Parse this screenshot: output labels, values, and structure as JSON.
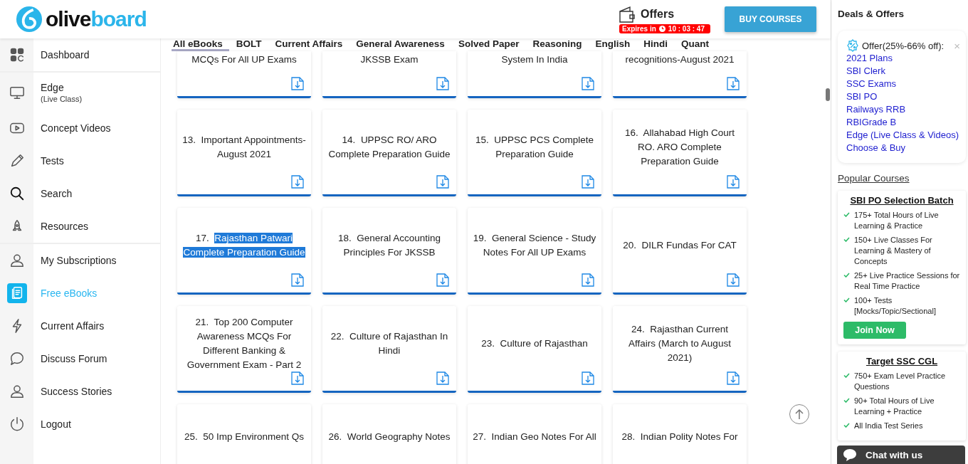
{
  "header": {
    "logo": {
      "dark": "olive",
      "light": "board"
    },
    "offers": {
      "label": "Offers",
      "expires_label": "Expires in",
      "countdown": "10 : 03 : 47"
    },
    "buy_button": "BUY COURSES"
  },
  "sidebar": {
    "groups": [
      [
        {
          "label": "Dashboard",
          "selected": false
        }
      ],
      [
        {
          "label": "Edge",
          "sublabel": "(Live Class)",
          "selected": false
        },
        {
          "label": "Concept Videos",
          "selected": false
        },
        {
          "label": "Tests",
          "selected": false
        },
        {
          "label": "Search",
          "selected": false
        },
        {
          "label": "Resources",
          "selected": false
        }
      ],
      [
        {
          "label": "My Subscriptions",
          "selected": false
        },
        {
          "label": "Free eBooks",
          "selected": true
        },
        {
          "label": "Current Affairs",
          "selected": false
        },
        {
          "label": "Discuss Forum",
          "selected": false
        },
        {
          "label": "Success Stories",
          "selected": false
        },
        {
          "label": "Logout",
          "selected": false
        }
      ]
    ]
  },
  "tabs": [
    {
      "label": "All eBooks",
      "selected": true
    },
    {
      "label": "BOLT",
      "selected": false
    },
    {
      "label": "Current Affairs",
      "selected": false
    },
    {
      "label": "General Awareness",
      "selected": false
    },
    {
      "label": "Solved Paper",
      "selected": false
    },
    {
      "label": "Reasoning",
      "selected": false
    },
    {
      "label": "English",
      "selected": false
    },
    {
      "label": "Hindi",
      "selected": false
    },
    {
      "label": "Quant",
      "selected": false
    }
  ],
  "ebook_rows": [
    [
      {
        "title": "MCQs For All UP Exams",
        "highlighted": false
      },
      {
        "title": "JKSSB Exam",
        "highlighted": false
      },
      {
        "title": "System In India",
        "highlighted": false
      },
      {
        "title": "recognitions-August 2021",
        "highlighted": false
      }
    ],
    [
      {
        "number": "13.",
        "title": "Important Appointments-August 2021",
        "highlighted": false
      },
      {
        "number": "14.",
        "title": "UPPSC RO/ ARO Complete Preparation Guide",
        "highlighted": false
      },
      {
        "number": "15.",
        "title": "UPPSC PCS Complete Preparation Guide",
        "highlighted": false
      },
      {
        "number": "16.",
        "title": "Allahabad High Court RO. ARO Complete Preparation Guide",
        "highlighted": false
      }
    ],
    [
      {
        "number": "17.",
        "title": "Rajasthan Patwari Complete Preparation Guide",
        "highlighted": true
      },
      {
        "number": "18.",
        "title": "General Accounting Principles For JKSSB",
        "highlighted": false
      },
      {
        "number": "19.",
        "title": "General Science - Study Notes For All UP Exams",
        "highlighted": false
      },
      {
        "number": "20.",
        "title": "DILR Fundas For CAT",
        "highlighted": false
      }
    ],
    [
      {
        "number": "21.",
        "title": "Top 200 Computer Awareness MCQs For Different Banking & Government Exam - Part 2",
        "highlighted": false
      },
      {
        "number": "22.",
        "title": "Culture of Rajasthan In Hindi",
        "highlighted": false
      },
      {
        "number": "23.",
        "title": "Culture of Rajasthan",
        "highlighted": false
      },
      {
        "number": "24.",
        "title": "Rajasthan Current Affairs (March to August 2021)",
        "highlighted": false
      }
    ],
    [
      {
        "number": "25.",
        "title": "50 Imp Environment Qs",
        "highlighted": false
      },
      {
        "number": "26.",
        "title": "World Geography Notes",
        "highlighted": false
      },
      {
        "number": "27.",
        "title": "Indian Geo Notes For All",
        "highlighted": false
      },
      {
        "number": "28.",
        "title": "Indian Polity Notes For",
        "highlighted": false
      }
    ]
  ],
  "deals": {
    "title": "Deals & Offers",
    "offer": {
      "label": "Offer(25%-66% off):",
      "close": "×",
      "links": [
        "2021 Plans",
        "SBI Clerk",
        "SSC Exams",
        "SBI PO",
        "Railways RRB",
        "RBIGrade B",
        "Edge (Live Class & Videos)",
        "Choose & Buy"
      ]
    }
  },
  "popular": {
    "title": "Popular Courses",
    "courses": [
      {
        "title": "SBI PO Selection Batch",
        "features": [
          "175+ Total Hours of Live Learning & Practice",
          "150+ Live Classes For Learning & Mastery of Concepts",
          "25+ Live Practice Sessions for Real Time Practice",
          "100+ Tests [Mocks/Topic/Sectional]"
        ],
        "button": "Join Now"
      },
      {
        "title": "Target SSC CGL",
        "features": [
          "750+ Exam Level Practice Questions",
          "90+ Total Hours of Live Learning + Practice",
          "All India Test Series"
        ]
      }
    ]
  },
  "chat": {
    "label": "Chat with us"
  }
}
